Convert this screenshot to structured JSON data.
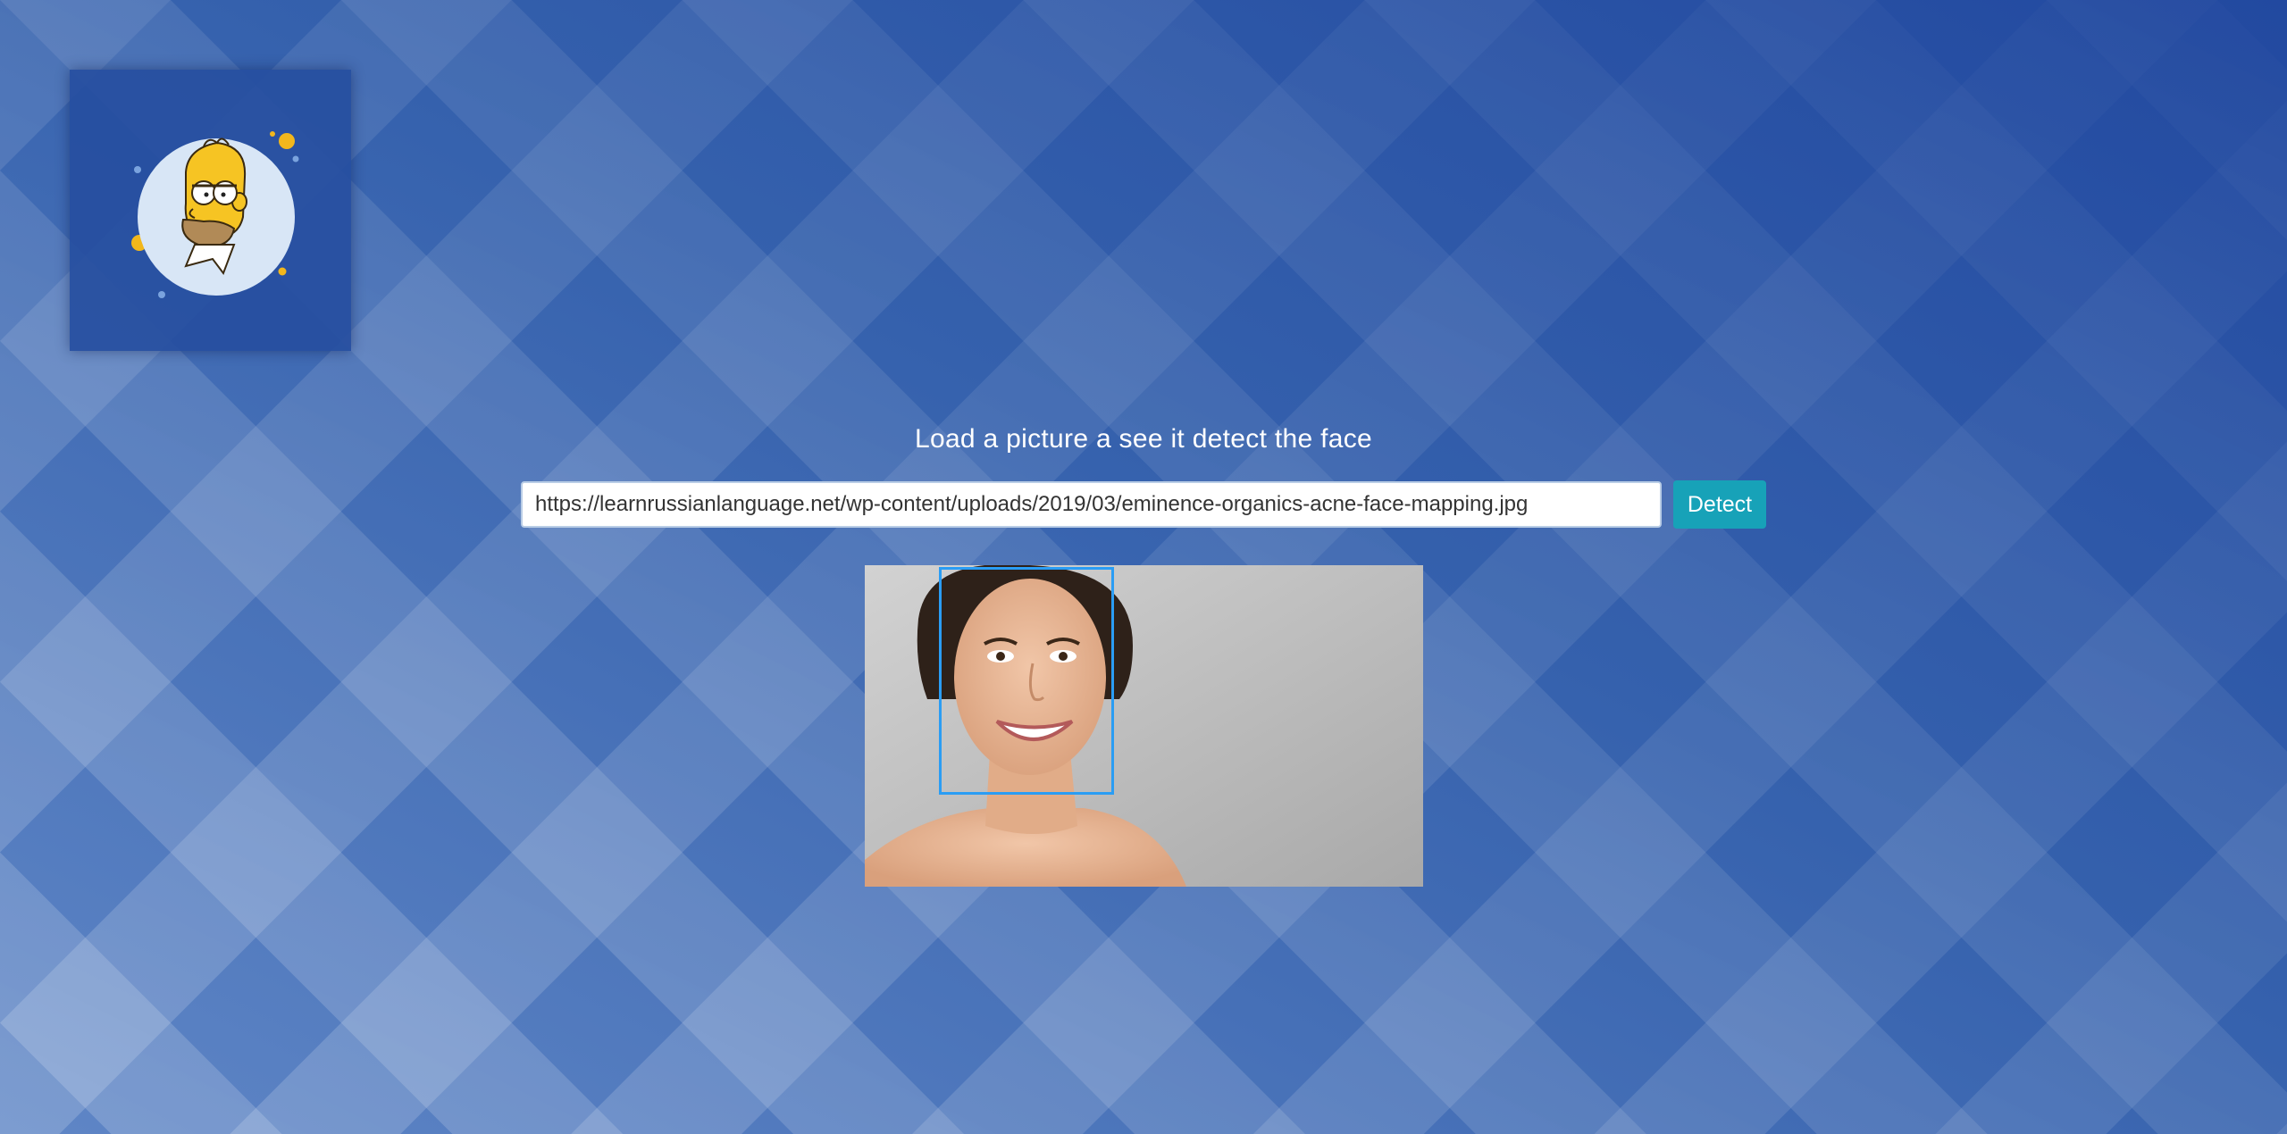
{
  "page": {
    "background_color": "#2a50a0",
    "accent": "#17a2b8",
    "face_box_color": "#2a9df4"
  },
  "logo": {
    "icon": "homer-face-logo"
  },
  "main": {
    "title": "Load a picture a see it detect the face",
    "url_input_value": "https://learnrussianlanguage.net/wp-content/uploads/2019/03/eminence-organics-acne-face-mapping.jpg",
    "detect_label": "Detect"
  },
  "result": {
    "image_icon": "portrait-photo",
    "face_count": 1
  }
}
